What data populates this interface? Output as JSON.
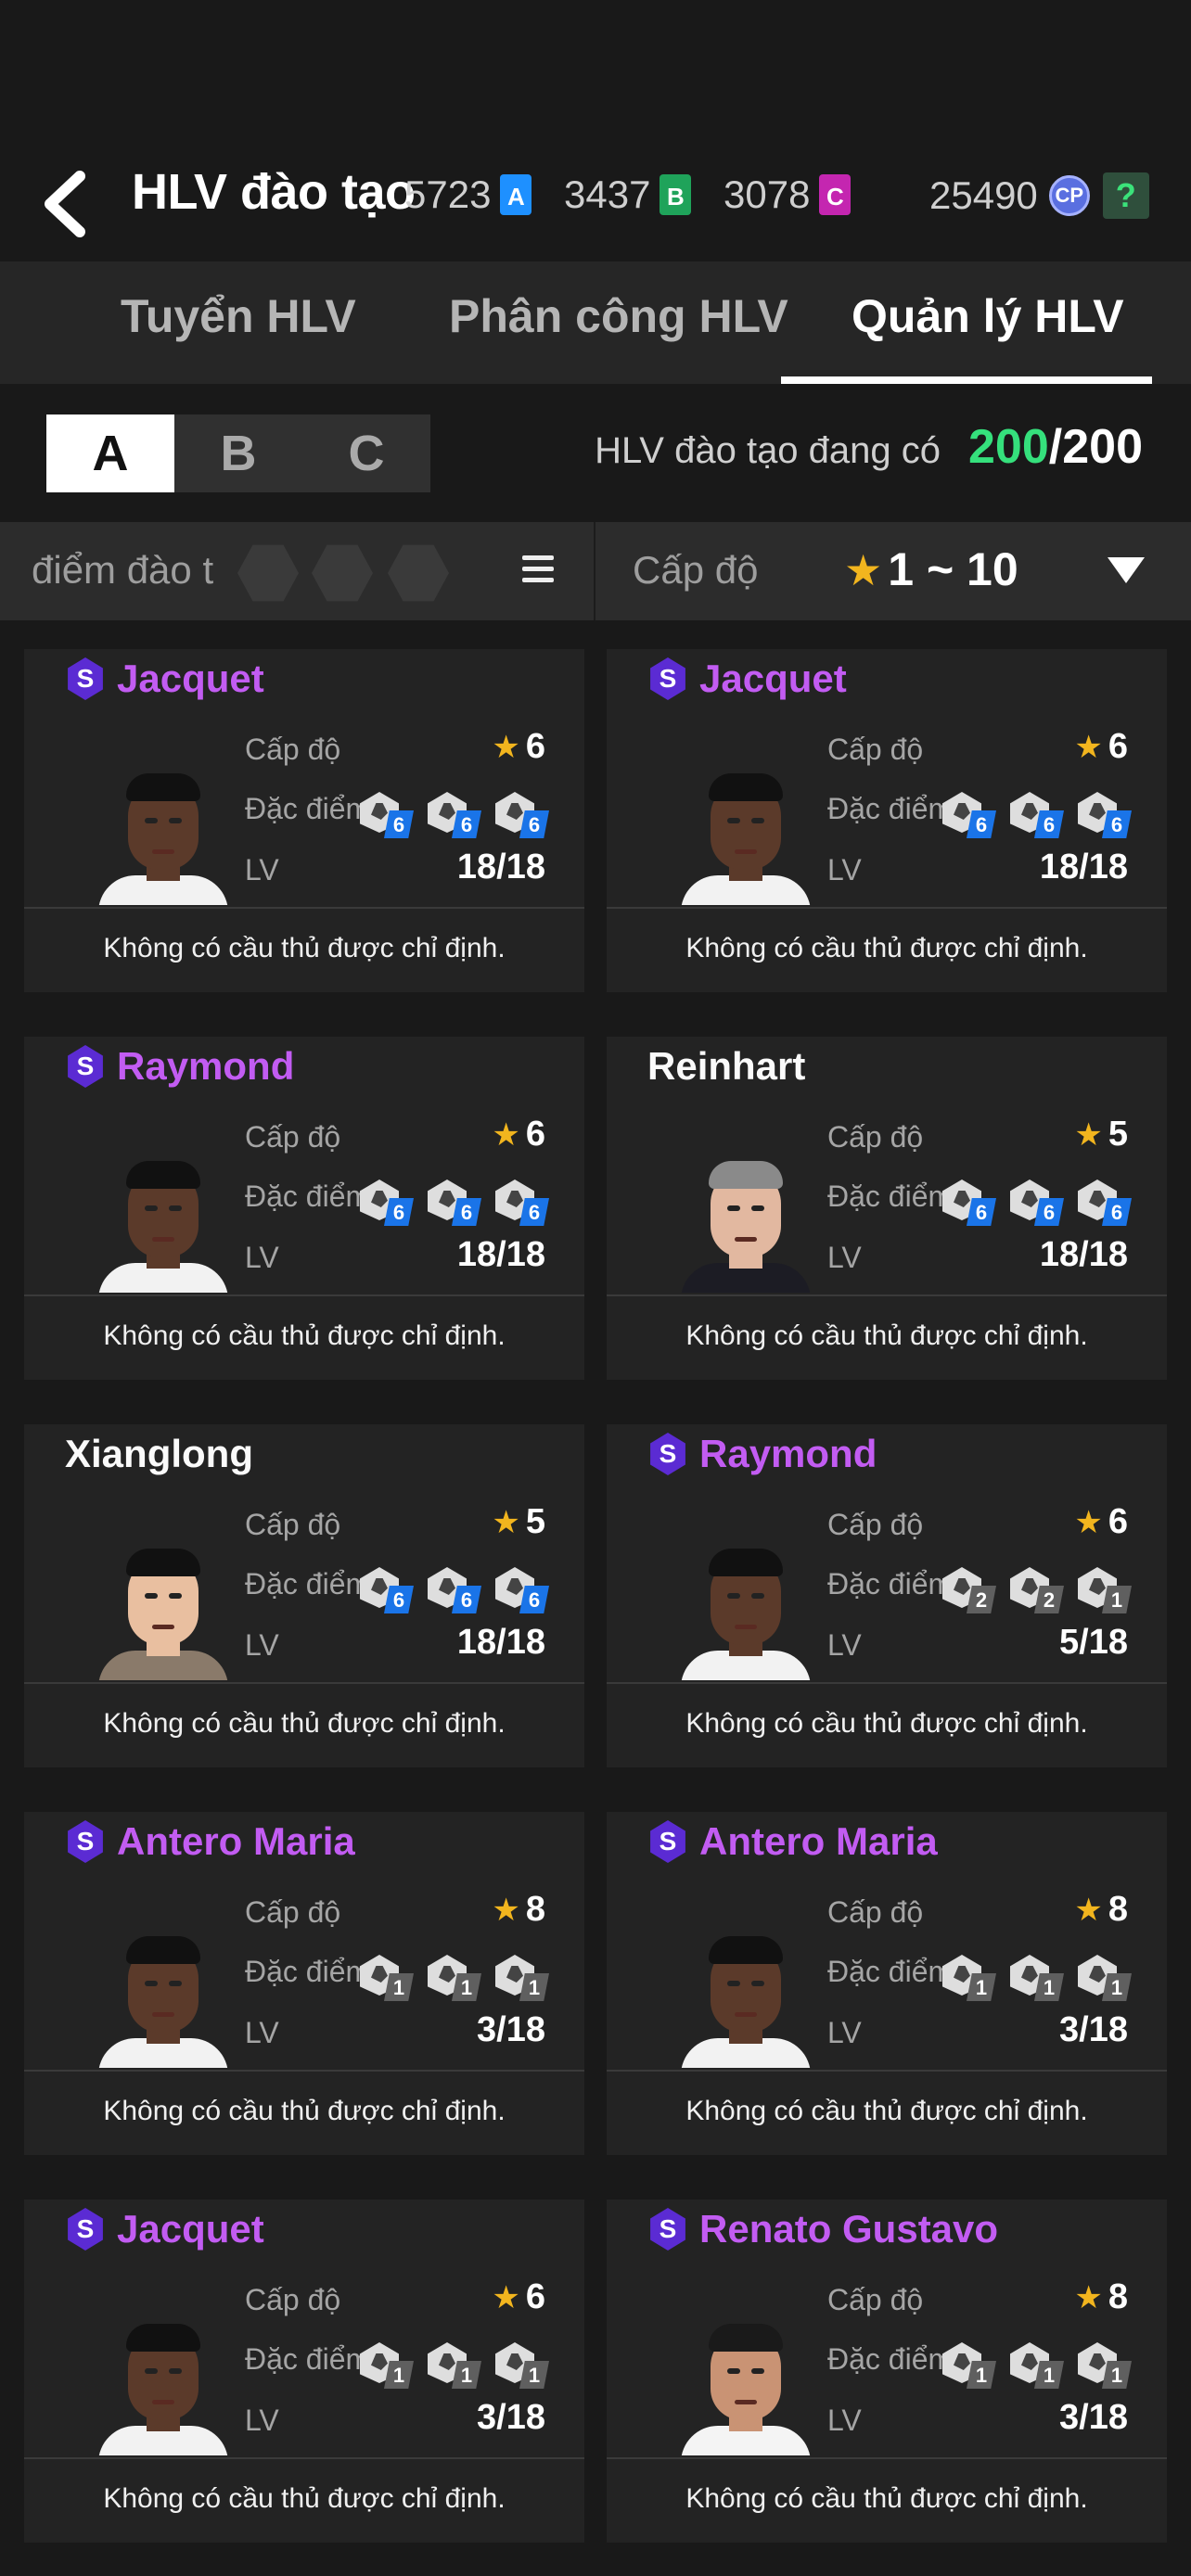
{
  "header": {
    "title": "HLV đào tạo",
    "currencies": [
      {
        "value": "5723",
        "tag": "A",
        "color": "#1e90ff"
      },
      {
        "value": "3437",
        "tag": "B",
        "color": "#1fa35a"
      },
      {
        "value": "3078",
        "tag": "C",
        "color": "#c426b0"
      }
    ],
    "cp_value": "25490",
    "cp_label": "CP",
    "help_label": "?"
  },
  "tabs": [
    "Tuyển HLV",
    "Phân công  HLV",
    "Quản lý HLV"
  ],
  "active_tab": 2,
  "segments": [
    "A",
    "B",
    "C"
  ],
  "active_segment": 0,
  "availability": {
    "label": "HLV đào tạo đang có",
    "count": "200",
    "total": "/200"
  },
  "filter": {
    "points_label": "điểm đào t",
    "level_label": "Cấp độ",
    "level_range": "1 ~ 10"
  },
  "labels": {
    "level": "Cấp độ",
    "traits": "Đặc điểm",
    "lv": "LV",
    "note": "Không có cầu thủ được chỉ định."
  },
  "coaches": [
    {
      "name": "Jacquet",
      "special": true,
      "stars": "6",
      "lv": "18/18",
      "traits": [
        "6",
        "6",
        "6"
      ],
      "trait_color": "blue",
      "face": "dark"
    },
    {
      "name": "Jacquet",
      "special": true,
      "stars": "6",
      "lv": "18/18",
      "traits": [
        "6",
        "6",
        "6"
      ],
      "trait_color": "blue",
      "face": "dark"
    },
    {
      "name": "Raymond",
      "special": true,
      "stars": "6",
      "lv": "18/18",
      "traits": [
        "6",
        "6",
        "6"
      ],
      "trait_color": "blue",
      "face": "dark"
    },
    {
      "name": "Reinhart",
      "special": false,
      "stars": "5",
      "lv": "18/18",
      "traits": [
        "6",
        "6",
        "6"
      ],
      "trait_color": "blue",
      "face": "light"
    },
    {
      "name": "Xianglong",
      "special": false,
      "stars": "5",
      "lv": "18/18",
      "traits": [
        "6",
        "6",
        "6"
      ],
      "trait_color": "blue",
      "face": "asian"
    },
    {
      "name": "Raymond",
      "special": true,
      "stars": "6",
      "lv": "5/18",
      "traits": [
        "2",
        "2",
        "1"
      ],
      "trait_color": "gray",
      "face": "dark"
    },
    {
      "name": "Antero Maria",
      "special": true,
      "stars": "8",
      "lv": "3/18",
      "traits": [
        "1",
        "1",
        "1"
      ],
      "trait_color": "gray",
      "face": "dark"
    },
    {
      "name": "Antero Maria",
      "special": true,
      "stars": "8",
      "lv": "3/18",
      "traits": [
        "1",
        "1",
        "1"
      ],
      "trait_color": "gray",
      "face": "dark"
    },
    {
      "name": "Jacquet",
      "special": true,
      "stars": "6",
      "lv": "3/18",
      "traits": [
        "1",
        "1",
        "1"
      ],
      "trait_color": "gray",
      "face": "dark"
    },
    {
      "name": "Renato Gustavo",
      "special": true,
      "stars": "8",
      "lv": "3/18",
      "traits": [
        "1",
        "1",
        "1"
      ],
      "trait_color": "gray",
      "face": "tan"
    }
  ],
  "face_colors": {
    "dark": {
      "skin": "#5b3a2a",
      "hair": "#111111",
      "shirt": "#f2f2f2"
    },
    "light": {
      "skin": "#e2b8a0",
      "hair": "#8a8a8a",
      "shirt": "#1c1c24"
    },
    "asian": {
      "skin": "#e9bfa0",
      "hair": "#111111",
      "shirt": "#8a7a6a"
    },
    "tan": {
      "skin": "#c99374",
      "hair": "#1a1a1a",
      "shirt": "#f4f4f4"
    }
  }
}
